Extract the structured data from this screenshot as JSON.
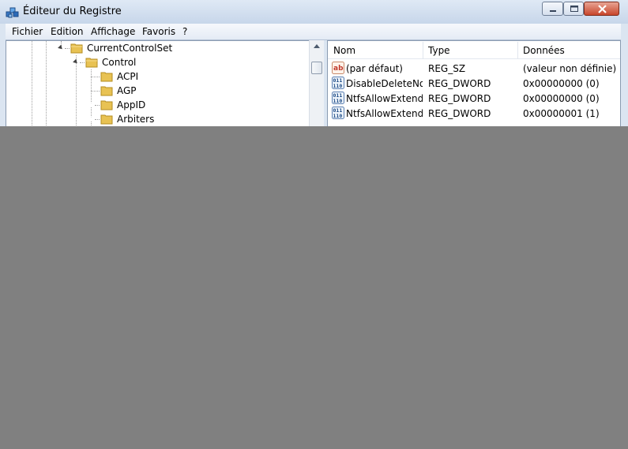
{
  "window": {
    "title": "Éditeur du Registre"
  },
  "menu": [
    "Fichier",
    "Edition",
    "Affichage",
    "Favoris",
    "?"
  ],
  "tree": [
    {
      "label": "CurrentControlSet",
      "state": "open"
    },
    {
      "label": "Control",
      "state": "open"
    },
    {
      "label": "ACPI",
      "state": "leaf"
    },
    {
      "label": "AGP",
      "state": "leaf"
    },
    {
      "label": "AppID",
      "state": "closed"
    },
    {
      "label": "Arbiters",
      "state": "closed"
    }
  ],
  "list": {
    "columns": [
      "Nom",
      "Type",
      "Données"
    ],
    "rows": [
      {
        "icon": "string-value-icon",
        "name": "(par défaut)",
        "type": "REG_SZ",
        "data": "(valeur non définie)"
      },
      {
        "icon": "binary-value-icon",
        "name": "DisableDeleteNo...",
        "type": "REG_DWORD",
        "data": "0x00000000 (0)"
      },
      {
        "icon": "binary-value-icon",
        "name": "NtfsAllowExtend...",
        "type": "REG_DWORD",
        "data": "0x00000000 (0)"
      },
      {
        "icon": "binary-value-icon",
        "name": "NtfsAllowExtend...",
        "type": "REG_DWORD",
        "data": "0x00000001 (1)"
      }
    ]
  }
}
